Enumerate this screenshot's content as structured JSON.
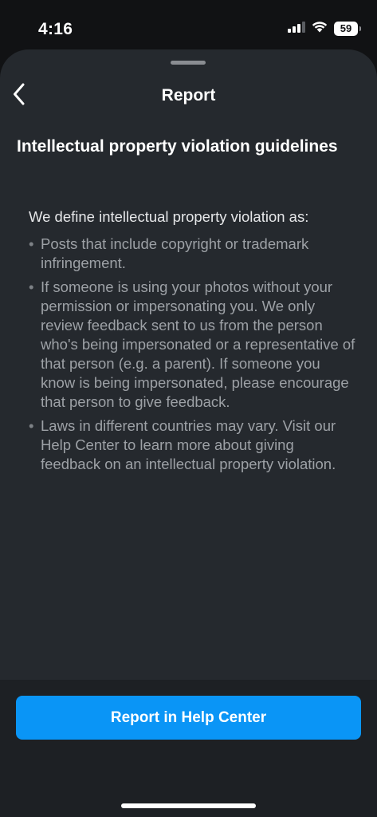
{
  "status_bar": {
    "time": "4:16",
    "battery_level": "59",
    "icons": [
      "signal-icon",
      "wifi-icon",
      "battery-icon"
    ]
  },
  "nav": {
    "title": "Report",
    "back_icon": "chevron-left-icon"
  },
  "content": {
    "heading": "Intellectual property violation guidelines",
    "definition": "We define intellectual property violation as:",
    "bullets": [
      {
        "text": "Posts that include copyright or trademark infringement."
      },
      {
        "text": "If someone is using your photos without your permission or impersonating you. We only review feedback sent to us from the person who's being impersonated or a representative of that person (e.g. a parent). If someone you know is being impersonated, please encourage that person to give feedback."
      },
      {
        "text": "Laws in different countries may vary. Visit our Help Center to learn more about giving feedback on an intellectual property violation."
      }
    ]
  },
  "footer": {
    "button_label": "Report in Help Center"
  },
  "colors": {
    "sheet_background": "#25292e",
    "footer_background": "#1d2024",
    "accent": "#0a95f6",
    "secondary_text": "#9da1a6"
  }
}
